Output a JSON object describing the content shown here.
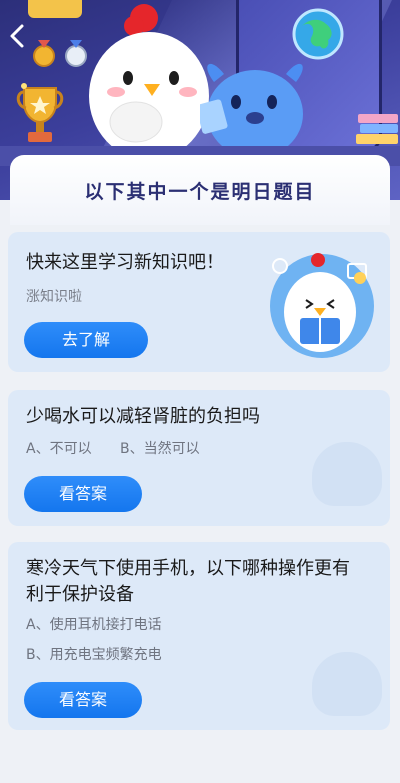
{
  "header": {
    "title": "以下其中一个是明日题目"
  },
  "cards": [
    {
      "title": "快来这里学习新知识吧！",
      "subtitle": "涨知识啦",
      "button": "去了解"
    },
    {
      "question": "少喝水可以减轻肾脏的负担吗",
      "option_a": "A、不可以",
      "option_b": "B、当然可以",
      "button": "看答案"
    },
    {
      "question_line1": "寒冷天气下使用手机，以下哪种操作更有",
      "question_line2": "利于保护设备",
      "option_a": "A、使用耳机接打电话",
      "option_b": "B、用充电宝频繁充电",
      "button": "看答案"
    }
  ],
  "colors": {
    "header_bg": "#3c3f9c",
    "card_bg": "#dde9f8",
    "button": "#1476ee"
  },
  "icons": [
    "back-chevron-icon",
    "trophy-icon",
    "medal-icon",
    "globe-icon",
    "chicken-mascot-icon",
    "blue-mascot-icon",
    "book-icon"
  ]
}
